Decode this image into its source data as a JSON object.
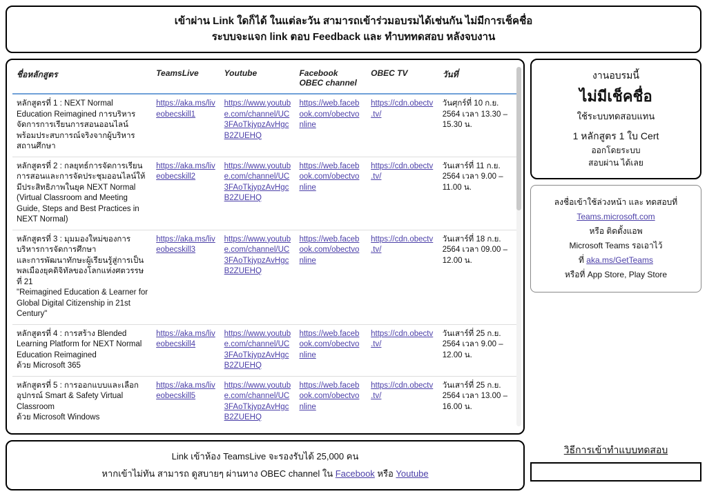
{
  "banner": {
    "line1": "เข้าผ่าน Link ใดก็ได้ ในแต่ละวัน  สามารถเข้าร่วมอบรมได้เช่นกัน  ไม่มีการเช็คชื่อ",
    "line2": "ระบบจะแจก link ตอบ Feedback และ ทำบททดสอบ หลังจบงาน"
  },
  "table": {
    "headers": {
      "course": "ชื่อหลักสูตร",
      "teams": "TeamsLive",
      "youtube": "Youtube",
      "facebook": "Facebook OBEC channel",
      "obectv": "OBEC TV",
      "date": "วันที่"
    },
    "youtube_url": "https://www.youtube.com/channel/UC3FAoTkjypzAvHgcB2ZUEHQ",
    "facebook_url": "https://web.facebook.com/obectvonline",
    "obectv_url": "https://cdn.obectv.tv/",
    "rows": [
      {
        "course": "หลักสูตรที่ 1 : NEXT Normal Education Reimagined การบริหารจัดการการเรียนการสอนออนไลน์ พร้อมประสบการณ์จริงจากผู้บริหารสถานศึกษา",
        "teams": "https://aka.ms/liveobecskill1",
        "date": "วันศุกร์ที่ 10 ก.ย. 2564 เวลา 13.30 – 15.30 น."
      },
      {
        "course": "หลักสูตรที่ 2 : กลยุทธ์การจัดการเรียนการสอนและการจัดประชุมออนไลน์ให้มีประสิทธิภาพในยุค NEXT Normal (Virtual Classroom and Meeting Guide, Steps and Best Practices in NEXT Normal)",
        "teams": "https://aka.ms/liveobecskill2",
        "date": "วันเสาร์ที่ 11 ก.ย. 2564 เวลา 9.00 – 11.00 น."
      },
      {
        "course": "หลักสูตรที่ 3 : มุมมองใหม่ของการบริหารการจัดการศึกษา\nและการพัฒนาทักษะผู้เรียนรู้สู่การเป็นพลเมืองยุคดิจิทัลของโลกแห่งศตวรรษที่ 21\n\"Reimagined Education & Learner for Global Digital Citizenship in 21st Century\"",
        "teams": "https://aka.ms/liveobecskill3",
        "date": "วันเสาร์ที่ 18 ก.ย. 2564 เวลา 09.00 – 12.00 น."
      },
      {
        "course": "หลักสูตรที่ 4 : การสร้าง Blended Learning Platform for NEXT Normal Education Reimagined\nด้วย Microsoft 365",
        "teams": "https://aka.ms/liveobecskill4",
        "date": "วันเสาร์ที่ 25 ก.ย. 2564 เวลา 9.00 – 12.00 น."
      },
      {
        "course": "หลักสูตรที่ 5 : การออกแบบและเลือกอุปกรณ์ Smart & Safety Virtual Classroom\nด้วย Microsoft Windows",
        "teams": "https://aka.ms/liveobecskill5",
        "date": "วันเสาร์ที่ 25 ก.ย. 2564 เวลา 13.00 – 16.00 น."
      }
    ]
  },
  "info": {
    "l1": "งานอบรมนี้",
    "l2": "ไม่มีเช็คชื่อ",
    "l3": "ใช้ระบบทดสอบแทน",
    "l4": "1 หลักสูตร 1 ใบ Cert",
    "l5": "ออกโดยระบบ",
    "l6": "สอบผ่าน ได้เลย"
  },
  "login": {
    "l1": "ลงชื่อเข้าใช้ล่วงหน้า และ ทดสอบที่",
    "link1_text": "Teams.microsoft.com",
    "l2": "หรือ ติดตั้งแอพ",
    "l3": "Microsoft Teams รอเอาไว้",
    "l4_pre": "ที่  ",
    "link2_text": "aka.ms/GetTeams",
    "l5": "หรือที่ App Store, Play Store"
  },
  "footer": {
    "l1": "Link เข้าห้อง TeamsLive จะรองรับได้ 25,000 คน",
    "l2_pre": "หากเข้าไม่ทัน สามารถ ดูสบายๆ ผ่านทาง OBEC channel ใน ",
    "fb": "Facebook",
    "mid": " หรือ ",
    "yt": "Youtube"
  },
  "test": {
    "title": "วิธีการเข้าทำแบบทดสอบ"
  }
}
